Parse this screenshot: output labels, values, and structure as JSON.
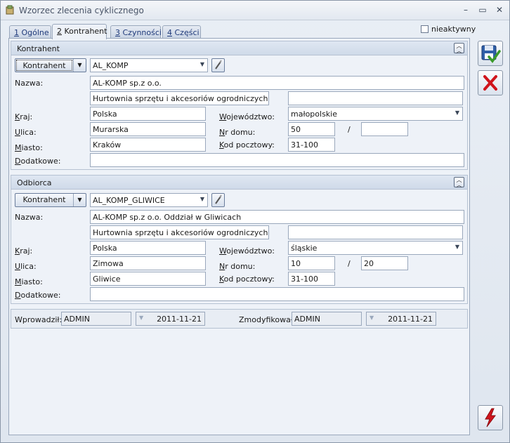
{
  "window": {
    "title": "Wzorzec zlecenia cyklicznego",
    "minimize_glyph": "–",
    "maximize_glyph": "▭",
    "close_glyph": "✕"
  },
  "tabs": [
    {
      "num": "1",
      "label": "Ogólne",
      "active": false
    },
    {
      "num": "2",
      "label": "Kontrahent",
      "active": true
    },
    {
      "num": "3",
      "label": "Czynności",
      "active": false
    },
    {
      "num": "4",
      "label": "Części",
      "active": false
    }
  ],
  "inactive_label": "nieaktywny",
  "kontrahent_group": {
    "title": "Kontrahent",
    "select_button": "Kontrahent",
    "code": "AL_KOMP",
    "labels": {
      "nazwa": "Nazwa:",
      "kraj": "Kraj:",
      "ulica": "Ulica:",
      "miasto": "Miasto:",
      "dodatkowe": "Dodatkowe:",
      "wojewodztwo": "Województwo:",
      "nr_domu": "Nr domu:",
      "kod_pocztowy": "Kod pocztowy:"
    },
    "nazwa1": "AL-KOMP sp.z o.o.",
    "nazwa2": "Hurtownia sprzętu i akcesoriów ogrodniczych",
    "nazwa3": "",
    "kraj": "Polska",
    "wojewodztwo": "małopolskie",
    "ulica": "Murarska",
    "nr_domu": "50",
    "nr_lokalu": "",
    "miasto": "Kraków",
    "kod_pocztowy": "31-100",
    "dodatkowe": ""
  },
  "odbiorca_group": {
    "title": "Odbiorca",
    "select_button": "Kontrahent",
    "code": "AL_KOMP_GLIWICE",
    "nazwa1": "AL-KOMP sp.z o.o. Oddział w Gliwicach",
    "nazwa2": "Hurtownia sprzętu i akcesoriów ogrodniczych",
    "nazwa3": "",
    "kraj": "Polska",
    "wojewodztwo": "śląskie",
    "ulica": "Zimowa",
    "nr_domu": "10",
    "nr_lokalu": "20",
    "miasto": "Gliwice",
    "kod_pocztowy": "31-100",
    "dodatkowe": ""
  },
  "slash": "/",
  "footer": {
    "entered_label": "Wprowadził:",
    "entered_by": "ADMIN",
    "entered_date": "2011-11-21",
    "modified_label": "Zmodyfikował:",
    "modified_by": "ADMIN",
    "modified_date": "2011-11-21"
  },
  "icons": {
    "save": "save-icon",
    "cancel": "cancel-icon",
    "action": "lightning-icon"
  },
  "colors": {
    "save_green": "#3a9a2a",
    "cancel_red": "#d0141c",
    "action_red": "#d0141c"
  }
}
